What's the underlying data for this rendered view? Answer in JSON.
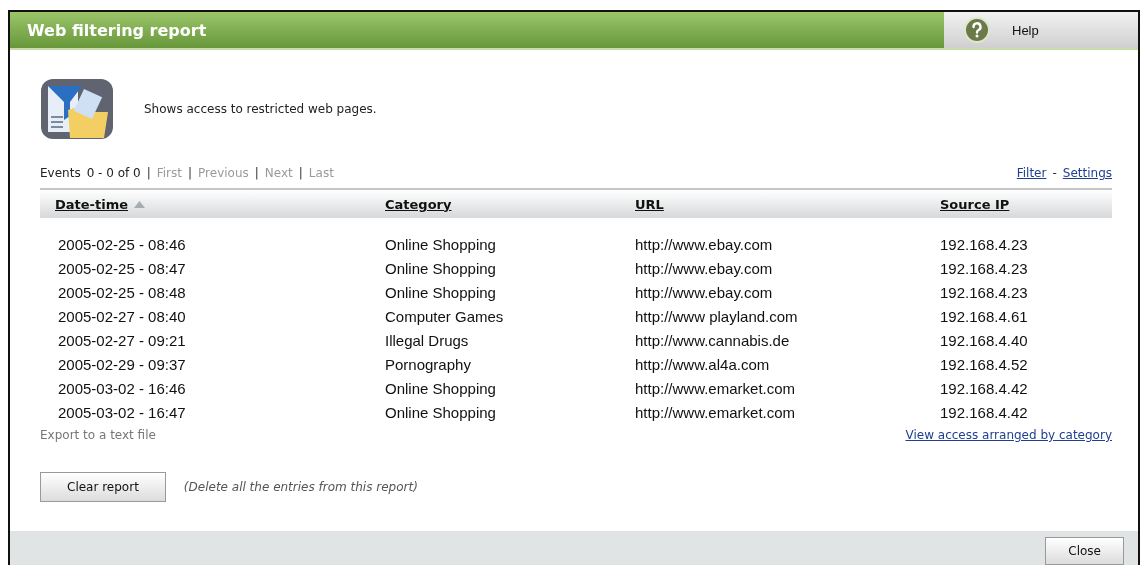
{
  "window": {
    "title": "Web filtering report",
    "help": "Help"
  },
  "description": "Shows access to restricted web pages.",
  "pager": {
    "label": "Events",
    "range": "0 - 0 of 0",
    "links": [
      {
        "separator": "|",
        "label": "First",
        "disabled": true
      },
      {
        "separator": "|",
        "label": "Previous",
        "disabled": true
      },
      {
        "separator": "|",
        "label": "Next",
        "disabled": true
      },
      {
        "separator": "|",
        "label": "Last",
        "disabled": true
      }
    ]
  },
  "top_links": [
    {
      "label": "Filter "
    },
    {
      "separator": "-",
      "label": "Settings"
    }
  ],
  "table": {
    "columns": [
      {
        "label": "Date-time",
        "sorted": true
      },
      {
        "label": "Category",
        "sorted": false
      },
      {
        "label": "URL",
        "sorted": false
      },
      {
        "label": "Source IP",
        "sorted": false
      }
    ],
    "rows": [
      [
        "2005-02-25 - 08:46",
        "Online Shopping",
        "http://www.ebay.com",
        "192.168.4.23"
      ],
      [
        "2005-02-25 - 08:47",
        "Online Shopping",
        "http://www.ebay.com",
        "192.168.4.23"
      ],
      [
        "2005-02-25 - 08:48",
        "Online Shopping",
        "http://www.ebay.com",
        "192.168.4.23"
      ],
      [
        "2005-02-27 - 08:40",
        "Computer Games",
        "http://www playland.com",
        "192.168.4.61"
      ],
      [
        "2005-02-27 - 09:21",
        "Illegal Drugs",
        "http://www.cannabis.de",
        "192.168.4.40"
      ],
      [
        "2005-02-29 - 09:37",
        "Pornography",
        "http://www.al4a.com",
        "192.168.4.52"
      ],
      [
        "2005-03-02 - 16:46",
        "Online Shopping",
        "http://www.emarket.com",
        "192.168.4.42"
      ],
      [
        "2005-03-02 - 16:47",
        "Online Shopping",
        "http://www.emarket.com",
        "192.168.4.42"
      ]
    ]
  },
  "export_link": "Export to a text file",
  "category_link": "View access arranged by category",
  "clear_button": "Clear report",
  "clear_note": "(Delete all the entries from this report)",
  "close_button": "Close"
}
